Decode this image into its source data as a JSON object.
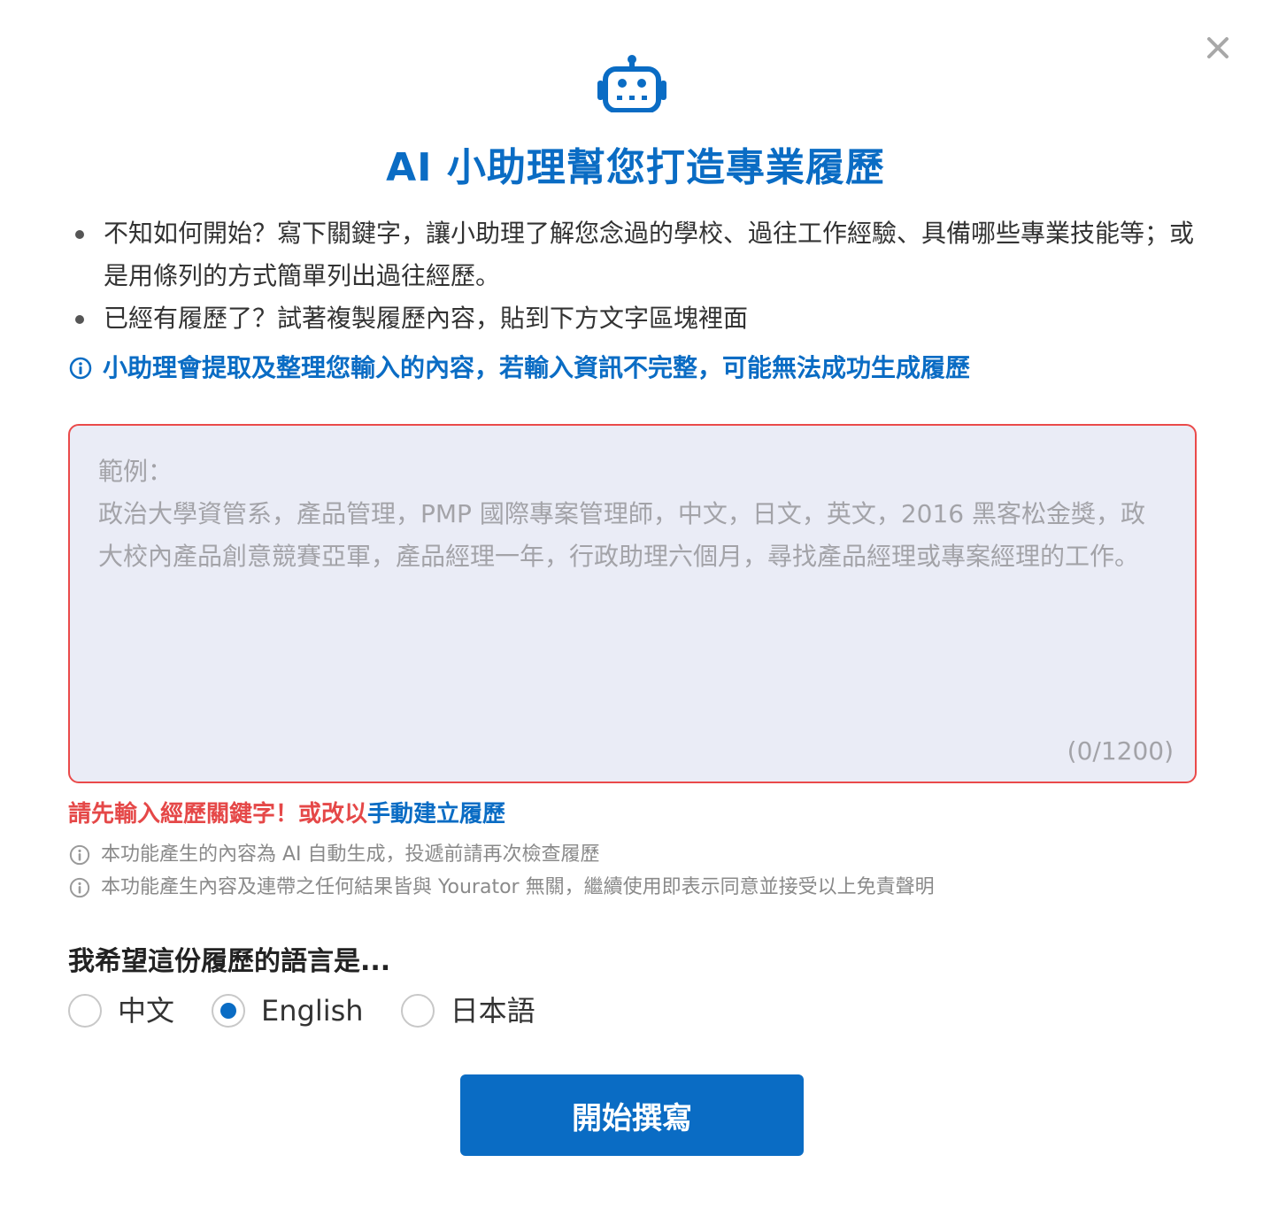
{
  "modal": {
    "close_icon": "close-icon",
    "header_icon": "robot-icon",
    "title": "AI 小助理幫您打造專業履歷"
  },
  "tips": [
    "不知如何開始？寫下關鍵字，讓小助理了解您念過的學校、過往工作經驗、具備哪些專業技能等；或是用條列的方式簡單列出過往經歷。",
    "已經有履歷了？試著複製履歷內容，貼到下方文字區塊裡面"
  ],
  "notice": "小助理會提取及整理您輸入的內容，若輸入資訊不完整，可能無法成功生成履歷",
  "input": {
    "value": "",
    "placeholder": "範例：\n政治大學資管系，產品管理，PMP 國際專案管理師，中文，日文，英文，2016 黑客松金獎，政大校內產品創意競賽亞軍，產品經理一年，行政助理六個月，尋找產品經理或專案經理的工作。",
    "counter": "(0/1200)"
  },
  "error": {
    "message": "請先輸入經歷關鍵字！或改以",
    "link": "手動建立履歷"
  },
  "disclaimers": [
    "本功能產生的內容為 AI 自動生成，投遞前請再次檢查履歷",
    "本功能產生內容及連帶之任何結果皆與 Yourator 無關，繼續使用即表示同意並接受以上免責聲明"
  ],
  "language": {
    "label": "我希望這份履歷的語言是...",
    "options": [
      {
        "label": "中文",
        "checked": false
      },
      {
        "label": "English",
        "checked": true
      },
      {
        "label": "日本語",
        "checked": false
      }
    ]
  },
  "submit_label": "開始撰寫",
  "colors": {
    "accent": "#0a6cc4",
    "error": "#e54848",
    "input_bg": "#eaecf6"
  }
}
